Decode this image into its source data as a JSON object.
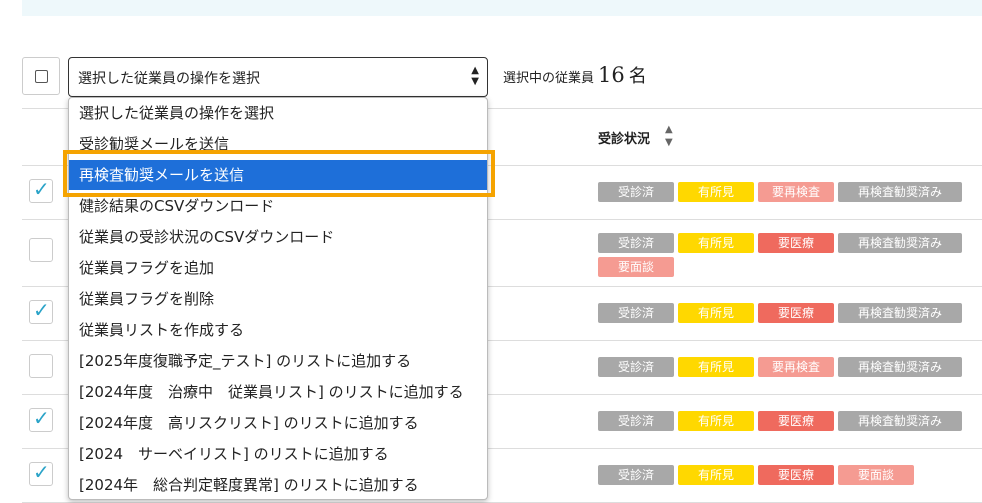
{
  "toolbar": {
    "select_value": "選択した従業員の操作を選択",
    "selected_label": "選択中の従業員",
    "selected_count": "16",
    "selected_unit": "名"
  },
  "table": {
    "status_column": "受診状況"
  },
  "dropdown": {
    "options": [
      "選択した従業員の操作を選択",
      "受診勧奨メールを送信",
      "再検査勧奨メールを送信",
      "健診結果のCSVダウンロード",
      "従業員の受診状況のCSVダウンロード",
      "従業員フラグを追加",
      "従業員フラグを削除",
      "従業員リストを作成する",
      "[2025年度復職予定_テスト] のリストに追加する",
      "[2024年度　治療中　従業員リスト] のリストに追加する",
      "[2024年度　高リスクリスト] のリストに追加する",
      "[2024　サーベイリスト] のリストに追加する",
      "[2024年　総合判定軽度異常] のリストに追加する"
    ],
    "active_index": 2
  },
  "rows": [
    {
      "checked": true,
      "badges": [
        "受診済",
        "有所見",
        "要再検査",
        "再検査勧奨済み"
      ]
    },
    {
      "checked": false,
      "badges": [
        "受診済",
        "有所見",
        "要医療",
        "再検査勧奨済み",
        "要面談"
      ]
    },
    {
      "checked": true,
      "badges": [
        "受診済",
        "有所見",
        "要医療",
        "再検査勧奨済み"
      ]
    },
    {
      "checked": false,
      "badges": [
        "受診済",
        "有所見",
        "要再検査",
        "再検査勧奨済み"
      ]
    },
    {
      "checked": true,
      "badges": [
        "受診済",
        "有所見",
        "要医療",
        "再検査勧奨済み"
      ]
    },
    {
      "checked": true,
      "badges": [
        "受診済",
        "有所見",
        "要医療",
        "要面談"
      ]
    }
  ],
  "colors": {
    "accent": "#1e6fd9",
    "highlight": "#f5a300",
    "badge_gray": "#a8a8a8",
    "badge_yellow": "#ffd800",
    "badge_pink": "#f59b92",
    "badge_red": "#ef6a5e",
    "check": "#2aa3c8"
  }
}
